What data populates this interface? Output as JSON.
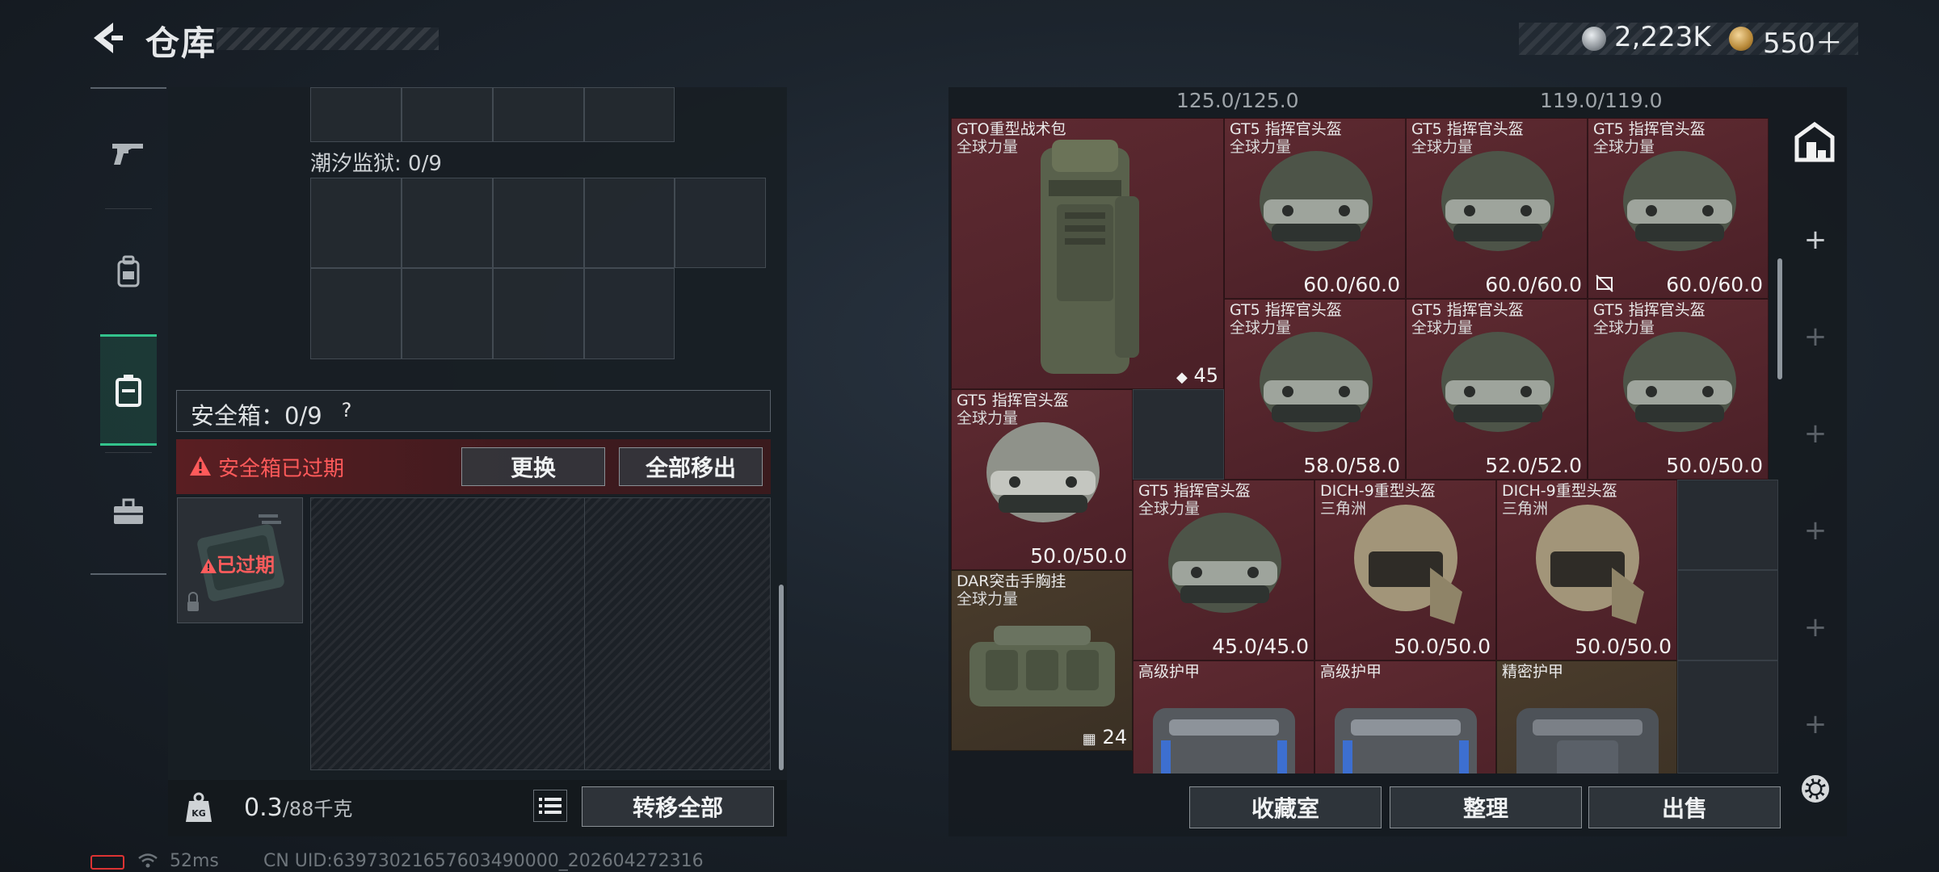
{
  "header": {
    "title": "仓库",
    "currency_silver": "2,223K",
    "currency_gold": "550＋"
  },
  "left": {
    "prison_label": "潮汐监狱: 0/9",
    "safebox_label": "安全箱：0/9",
    "safebox_help": "?",
    "expired_warning": "安全箱已过期",
    "replace_button": "更换",
    "move_all_button": "全部移出",
    "case_status": "已过期",
    "weight_value": "0.3",
    "weight_capacity": "/88千克",
    "transfer_all_button": "转移全部"
  },
  "right": {
    "top_durability_1": "125.0/125.0",
    "top_durability_2": "119.0/119.0",
    "items": [
      {
        "name": "GTO重型战术包",
        "sub": "全球力量",
        "badge": "45"
      },
      {
        "name": "GT5 指挥官头盔",
        "sub": "全球力量",
        "dur": "60.0/60.0"
      },
      {
        "name": "GT5 指挥官头盔",
        "sub": "全球力量",
        "dur": "60.0/60.0"
      },
      {
        "name": "GT5 指挥官头盔",
        "sub": "全球力量",
        "dur": "60.0/60.0"
      },
      {
        "name": "GT5 指挥官头盔",
        "sub": "全球力量",
        "dur": "58.0/58.0"
      },
      {
        "name": "GT5 指挥官头盔",
        "sub": "全球力量",
        "dur": "52.0/52.0"
      },
      {
        "name": "GT5 指挥官头盔",
        "sub": "全球力量",
        "dur": "50.0/50.0"
      },
      {
        "name": "GT5 指挥官头盔",
        "sub": "全球力量",
        "dur": "50.0/50.0"
      },
      {
        "name": "GT5 指挥官头盔",
        "sub": "全球力量",
        "dur": "45.0/45.0"
      },
      {
        "name": "DICH-9重型头盔",
        "sub": "三角洲",
        "dur": "50.0/50.0"
      },
      {
        "name": "DICH-9重型头盔",
        "sub": "三角洲",
        "dur": "50.0/50.0"
      },
      {
        "name": "DAR突击手胸挂",
        "sub": "全球力量",
        "badge": "24"
      },
      {
        "name": "高级护甲",
        "sub": ""
      },
      {
        "name": "高级护甲",
        "sub": ""
      },
      {
        "name": "精密护甲",
        "sub": ""
      }
    ],
    "vault_button": "收藏室",
    "sort_button": "整理",
    "sell_button": "出售"
  },
  "status": {
    "ping": "52ms",
    "uid": "CN UID:639730216576034900​00_202604272316"
  },
  "colors": {
    "accent_green": "#33c38c",
    "warning_red": "#ff5a5a",
    "item_red_bg": "#5e2a31",
    "item_brown_bg": "#4a3c2c"
  },
  "icons": {
    "nav": [
      "pistol-icon",
      "backpack-icon",
      "safebox-icon",
      "toolbox-icon"
    ],
    "side": [
      "warehouse-icon",
      "plus-icon",
      "gear-icon"
    ]
  }
}
